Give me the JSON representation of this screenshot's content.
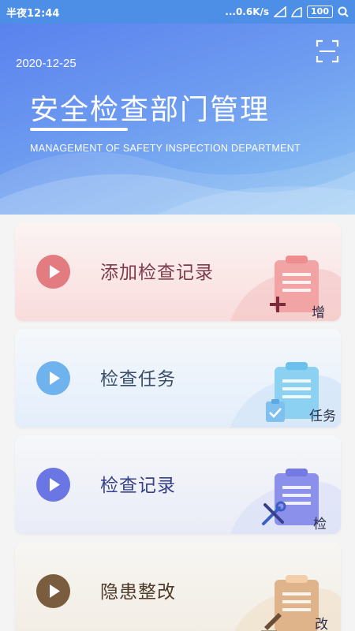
{
  "status_bar": {
    "left": "半夜12:44",
    "speed": "...0.6K/s",
    "battery": "100"
  },
  "header": {
    "date": "2020-12-25",
    "title": "安全检查部门管理",
    "subtitle": "MANAGEMENT OF SAFETY INSPECTION DEPARTMENT",
    "scan_icon": "scan-icon"
  },
  "cards": [
    {
      "label": "添加检查记录",
      "corner": "增",
      "color": "#e37c80",
      "text_color": "#7d3a4a",
      "icon": "add-record-icon"
    },
    {
      "label": "检查任务",
      "corner": "任务",
      "color": "#6fb3ee",
      "text_color": "#3c4f6a",
      "icon": "task-clipboard-icon"
    },
    {
      "label": "检查记录",
      "corner": "检",
      "color": "#6a76e4",
      "text_color": "#36408a",
      "icon": "tools-icon"
    },
    {
      "label": "隐患整改",
      "corner": "改",
      "color": "#7a5c3e",
      "text_color": "#4e3a28",
      "icon": "edit-icon"
    }
  ]
}
